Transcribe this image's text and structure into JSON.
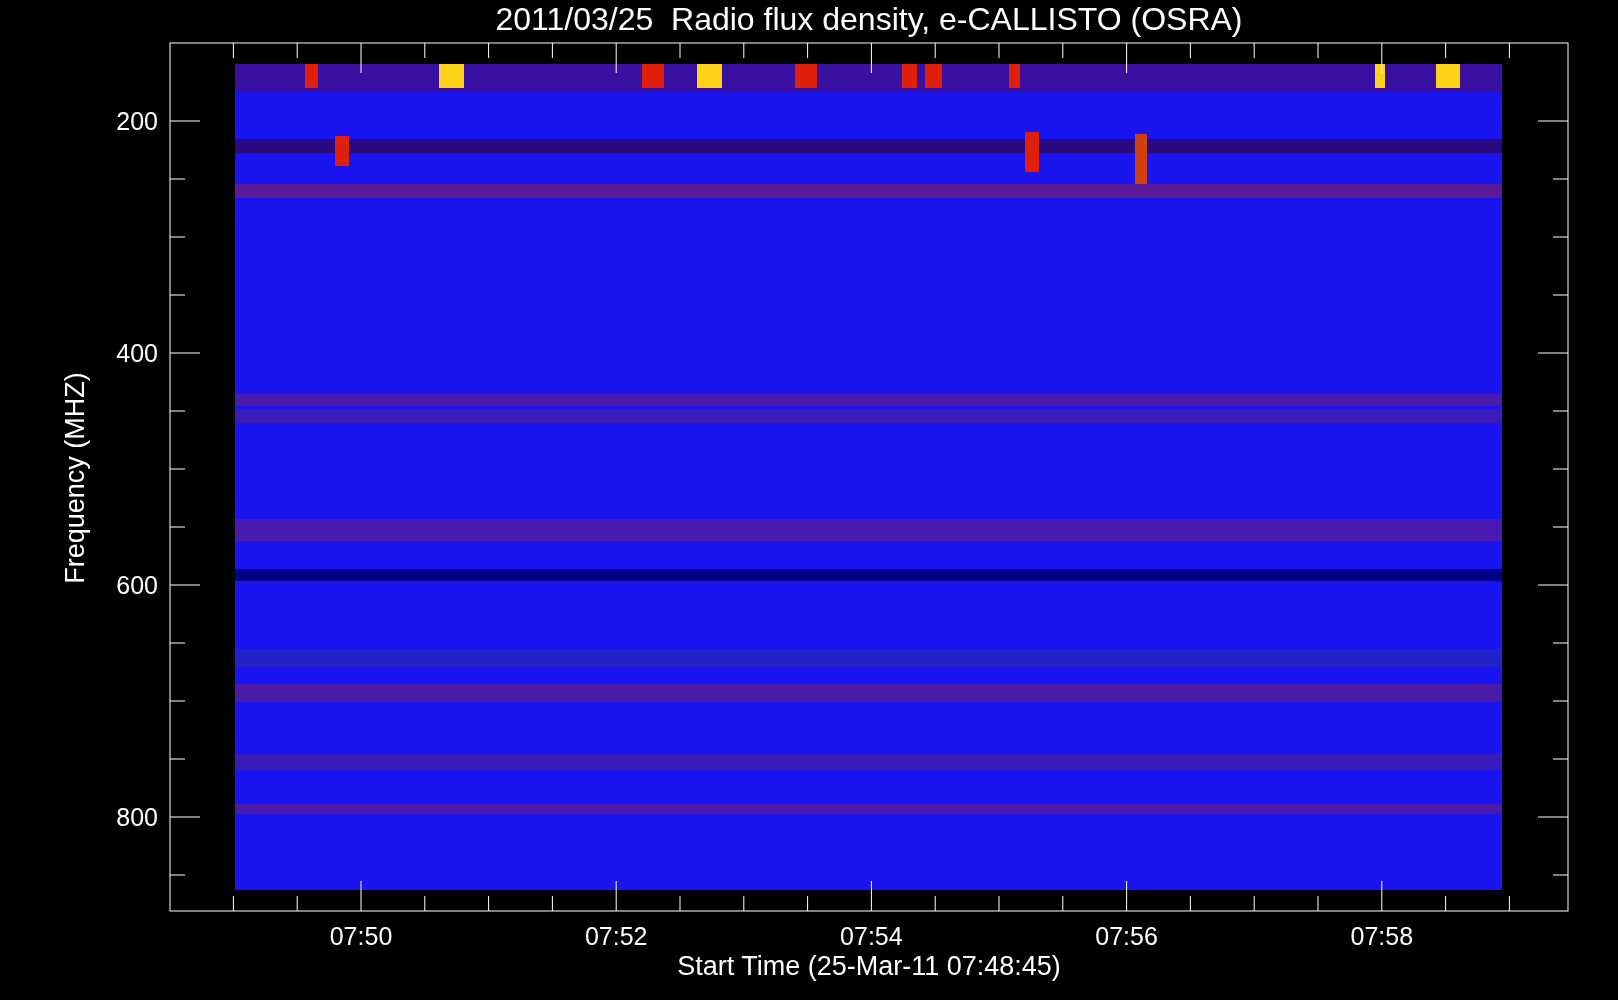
{
  "title": "2011/03/25  Radio flux density, e-CALLISTO (OSRA)",
  "y_axis": {
    "label": "Frequency (MHZ)",
    "ticks": [
      "200",
      "400",
      "600",
      "800"
    ]
  },
  "x_axis": {
    "label": "Start Time (25-Mar-11 07:48:45)",
    "ticks": [
      "07:50",
      "07:52",
      "07:54",
      "07:56",
      "07:58"
    ]
  }
}
